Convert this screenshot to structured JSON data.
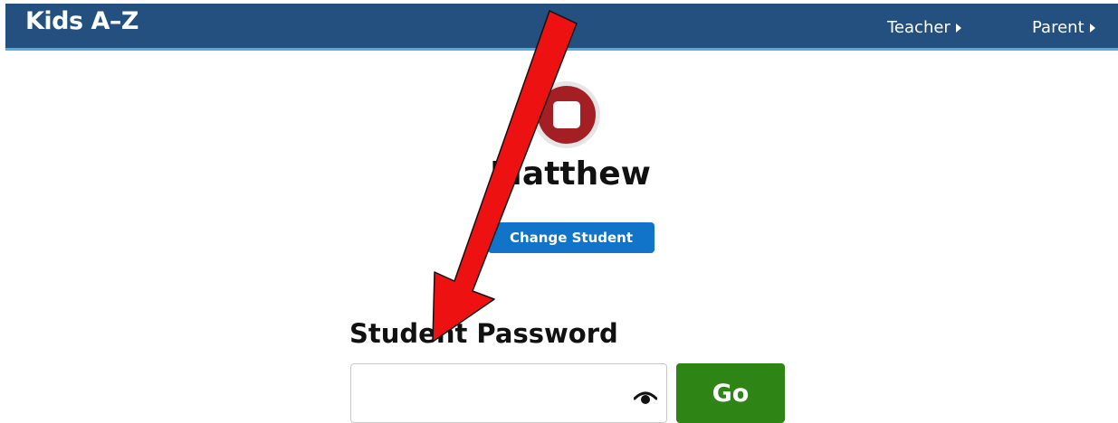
{
  "header": {
    "logo_text": "Kids A–Z",
    "nav": {
      "teacher_label": "Teacher",
      "parent_label": "Parent"
    }
  },
  "student": {
    "name": "Matthew",
    "change_label": "Change Student"
  },
  "login": {
    "password_label": "Student Password",
    "password_value": "",
    "go_label": "Go"
  },
  "icons": {
    "avatar": "stop-square-icon",
    "password_toggle": "eye-icon",
    "nav_caret": "caret-right-icon",
    "annotation": "arrow-icon"
  },
  "colors": {
    "header_bg": "#23507f",
    "header_border": "#5aa9dd",
    "avatar_red": "#a31f24",
    "change_button": "#1174c8",
    "go_button": "#2e8415",
    "annotation_arrow": "#ee1111"
  }
}
